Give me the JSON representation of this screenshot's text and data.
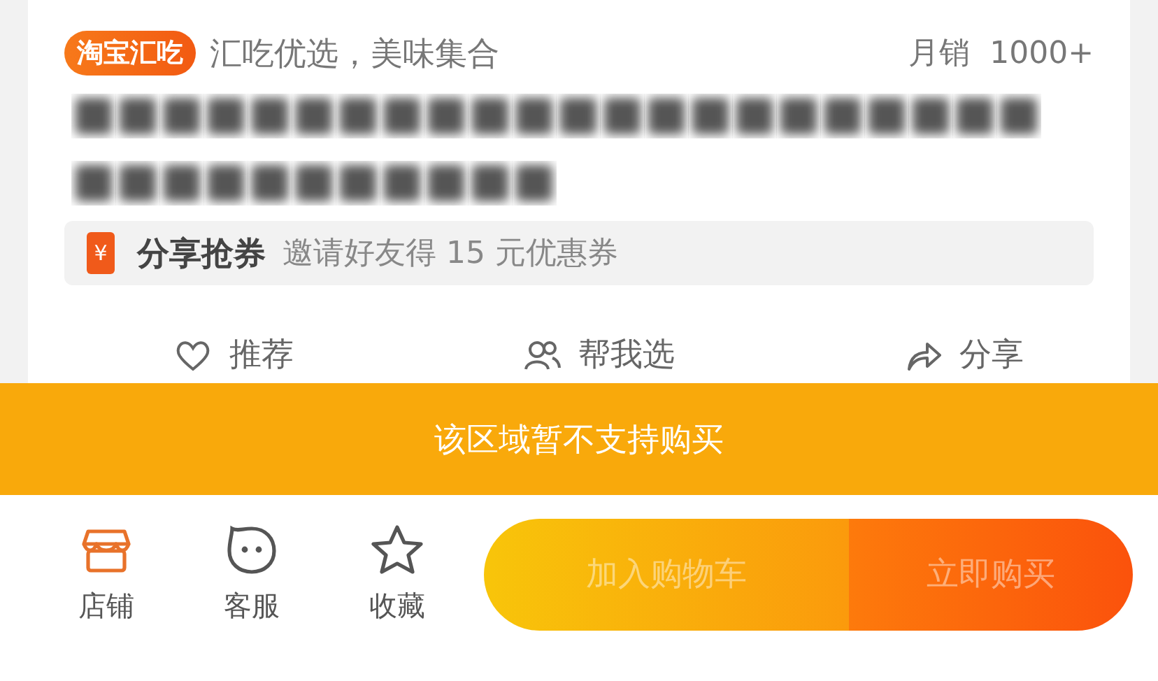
{
  "shop_tag": "淘宝汇吃",
  "slogan": "汇吃优选，美味集合",
  "sales": {
    "label": "月销",
    "value": "1000+"
  },
  "title": {
    "kind": "blurred"
  },
  "coupon": {
    "icon": "¥",
    "title": "分享抢券",
    "text": "邀请好友得 15 元优惠券"
  },
  "actions": [
    {
      "kind": "heart",
      "label": "推荐"
    },
    {
      "kind": "people",
      "label": "帮我选"
    },
    {
      "kind": "share",
      "label": "分享"
    }
  ],
  "notice": "该区域暂不支持购买",
  "tabs": [
    {
      "kind": "shop",
      "label": "店铺",
      "selected": true
    },
    {
      "kind": "service",
      "label": "客服",
      "selected": false
    },
    {
      "kind": "star",
      "label": "收藏",
      "selected": false
    }
  ],
  "buttons": [
    {
      "kind": "cart",
      "label": "加入购物车",
      "disabled": true
    },
    {
      "kind": "buy",
      "label": "立即购买",
      "disabled": true
    }
  ]
}
